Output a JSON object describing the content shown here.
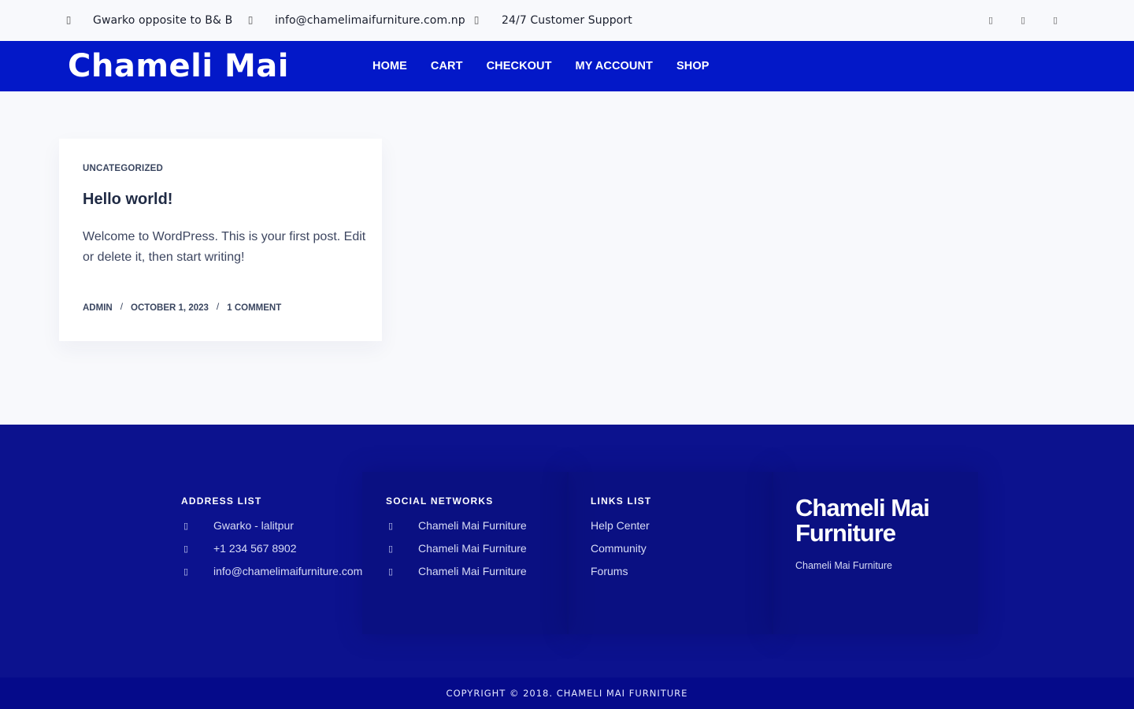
{
  "topbar": {
    "address": "Gwarko opposite to B& B",
    "email": "info@chamelimaifurniture.com.np",
    "support": "24/7 Customer Support",
    "icons": [
      "map-marker-icon",
      "envelope-icon",
      "phone-icon"
    ],
    "social_icons": [
      "facebook-icon",
      "twitter-icon",
      "instagram-icon"
    ]
  },
  "header": {
    "logo": "Chameli Mai",
    "nav": [
      "HOME",
      "CART",
      "CHECKOUT",
      "MY ACCOUNT",
      "SHOP"
    ]
  },
  "post": {
    "category": "UNCATEGORIZED",
    "title": "Hello world!",
    "excerpt": "Welcome to WordPress. This is your first post. Edit or delete it, then start writing!",
    "author": "ADMIN",
    "date": "OCTOBER 1, 2023",
    "comments": "1 COMMENT",
    "separator": "/"
  },
  "footer": {
    "address_list": {
      "heading": "ADDRESS LIST",
      "items": [
        "Gwarko - lalitpur",
        "+1 234 567 8902",
        "info@chamelimaifurniture.com"
      ]
    },
    "social_networks": {
      "heading": "SOCIAL NETWORKS",
      "items": [
        "Chameli Mai Furniture",
        "Chameli Mai Furniture",
        "Chameli Mai Furniture"
      ]
    },
    "links_list": {
      "heading": "LINKS LIST",
      "items": [
        "Help Center",
        "Community",
        "Forums"
      ]
    },
    "brand": {
      "title": "Chameli Mai Furniture",
      "subtitle": "Chameli Mai Furniture"
    },
    "copyright": "COPYRIGHT © 2018. CHAMELI MAI FURNITURE"
  },
  "colors": {
    "header_bg": "#0318c8",
    "footer_bg": "#0c128e",
    "copyright_bg": "#050a8a",
    "page_bg": "#f8f9fc"
  }
}
